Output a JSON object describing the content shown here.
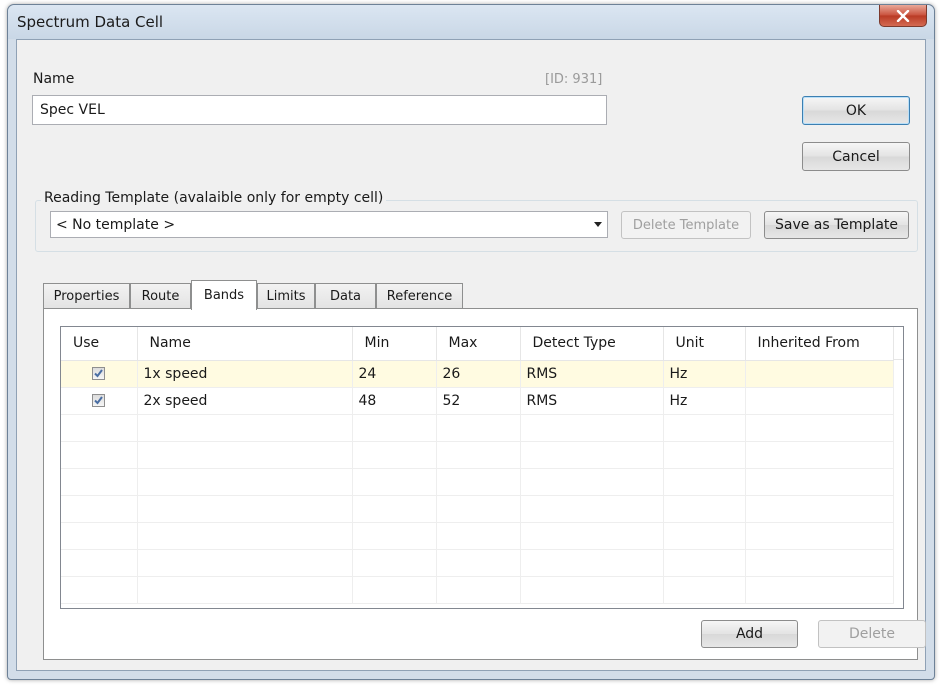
{
  "window": {
    "title": "Spectrum Data Cell",
    "close_glyph": "x"
  },
  "name_section": {
    "label": "Name",
    "id_label": "[ID: 931]",
    "value": "Spec VEL"
  },
  "buttons": {
    "ok": "OK",
    "cancel": "Cancel",
    "delete_template": "Delete Template",
    "save_template": "Save as Template",
    "add": "Add",
    "delete": "Delete"
  },
  "template": {
    "group_label": "Reading Template (avalaible only for empty cell)",
    "selected": "< No template >"
  },
  "tabs": [
    {
      "label": "Properties",
      "active": false
    },
    {
      "label": "Route",
      "active": false
    },
    {
      "label": "Bands",
      "active": true
    },
    {
      "label": "Limits",
      "active": false
    },
    {
      "label": "Data",
      "active": false
    },
    {
      "label": "Reference",
      "active": false
    }
  ],
  "bands_table": {
    "columns": [
      "Use",
      "Name",
      "Min",
      "Max",
      "Detect Type",
      "Unit",
      "Inherited From"
    ],
    "rows": [
      {
        "use": true,
        "name": "1x speed",
        "min": "24",
        "max": "26",
        "detect_type": "RMS",
        "unit": "Hz",
        "inherited_from": ""
      },
      {
        "use": true,
        "name": "2x speed",
        "min": "48",
        "max": "52",
        "detect_type": "RMS",
        "unit": "Hz",
        "inherited_from": ""
      }
    ],
    "selected_row": 0
  },
  "colors": {
    "selected_row_bg": "#fffbe1",
    "close_button": "#c9503b",
    "checkmark": "#4a6ea3"
  }
}
